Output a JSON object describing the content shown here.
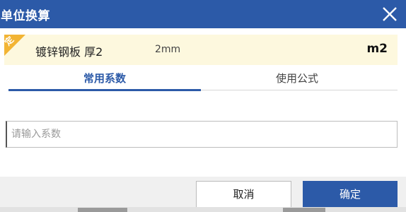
{
  "dialog": {
    "title": "单位换算",
    "close_icon": "close-icon"
  },
  "item": {
    "corner_tag": "定",
    "name": "镀锌钢板 厚2",
    "spec": "2mm",
    "unit": "m2"
  },
  "tabs": [
    {
      "label": "常用系数",
      "active": true
    },
    {
      "label": "使用公式",
      "active": false
    }
  ],
  "input": {
    "placeholder": "请输入系数",
    "value": ""
  },
  "buttons": {
    "cancel": "取消",
    "ok": "确定"
  },
  "colors": {
    "primary": "#2c5aa8",
    "item_bg": "#fdf8de",
    "tag": "#f2b434"
  }
}
